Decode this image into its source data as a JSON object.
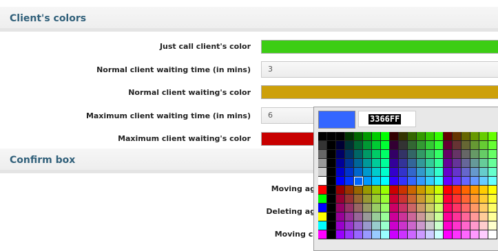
{
  "sections": {
    "clients_colors": {
      "title": "Client's colors"
    },
    "confirm_box": {
      "title": "Confirm box"
    }
  },
  "rows": {
    "just_call_color": {
      "label": "Just call client's color",
      "color": "#3ccd14"
    },
    "normal_wait_time": {
      "label": "Normal client waiting time (in mins)",
      "value": "3"
    },
    "normal_wait_color": {
      "label": "Normal client waiting's color",
      "color": "#cda00a"
    },
    "max_wait_time": {
      "label": "Maximum client waiting time (in mins)",
      "value": "6"
    },
    "max_wait_color": {
      "label": "Maximum client waiting's color",
      "color": "#c80000"
    }
  },
  "confirm": {
    "moving_a": "Moving ag",
    "deleting_a": "Deleting ag",
    "moving_c": "Moving cl"
  },
  "color_picker": {
    "current_color": "#3366FF",
    "hex_value": "3366FF",
    "accent_text_color": "#31607a"
  }
}
